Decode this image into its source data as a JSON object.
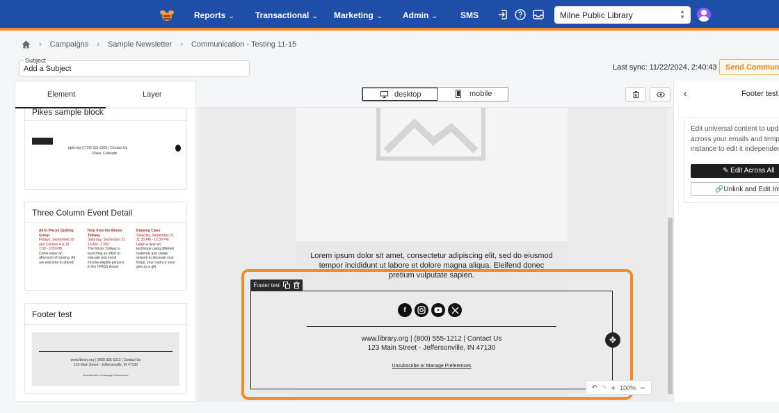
{
  "nav": {
    "items": [
      {
        "label": "Reports"
      },
      {
        "label": "Transactional"
      },
      {
        "label": "Marketing"
      },
      {
        "label": "Admin"
      },
      {
        "label": "SMS"
      }
    ],
    "chevron": "⌄",
    "library_select": "Milne Public Library"
  },
  "breadcrumb": {
    "items": [
      "Campaigns",
      "Sample Newsletter",
      "Communication - Testing 11-15"
    ]
  },
  "subject": {
    "label": "Subject",
    "value": "Add a Subject"
  },
  "sync": {
    "text": "Last sync: 11/22/2024, 2:40:43 PM"
  },
  "send_button": "Send Communication",
  "left_panel": {
    "tabs": [
      "Element",
      "Layer"
    ],
    "blocks": [
      {
        "title": "Pikes sample block",
        "preview_contact": "ppld.org  |  (719) 531-6333  |  Contact Us",
        "preview_city": "Pikes, Colorado"
      },
      {
        "title": "Three Column Event Detail",
        "col1_title": "All In Pieces Quilting Group",
        "col1_date": "Fridays, September 20 and October 4 & 18",
        "col1_time": "1:30 - 3:30 PM",
        "col1_body": "Come enjoy an afternoon of sewing. All are welcome to attend!",
        "col2_title": "Help from the Illinois Tollway",
        "col2_date": "Saturday, September 21",
        "col2_time": "10 AM - 2 PM",
        "col2_body": "The Illinois Tollway is launching an effort to educate and enroll income-eligible persons in the I-PASS Assist",
        "col3_title": "Drawing Class",
        "col3_date": "Saturday, September 21",
        "col3_time": "11:30 AM - 12:30 PM",
        "col3_body": "Learn a new art technique using different materials and create artwork to decorate your fridge, your room or even give as a gift."
      },
      {
        "title": "Footer test",
        "preview_contact": "www.library.org  |  (800) 555-1212  |  Contact Us",
        "preview_address": "123 Main Street - Jeffersonville, IN 47130",
        "preview_unsub": "Unsubscribe or Manage Preferences"
      }
    ]
  },
  "view_toggle": {
    "desktop": "desktop",
    "mobile": "mobile"
  },
  "canvas": {
    "lorem": "Lorem ipsum dolor sit amet, consectetur adipiscing elit, sed do eiusmod tempor incididunt ut labore et dolore magna aliqua. Eleifend donec pretium vulputate sapien.",
    "footer_tag": "Footer test",
    "footer_contact": "www.library.org   |   (800) 555-1212   |   Contact Us",
    "footer_address": "123 Main Street - Jeffersonville, IN 47130",
    "footer_unsub": "Unsubscribe or Manage Preferences",
    "social_icons": [
      "facebook-icon",
      "instagram-icon",
      "youtube-icon",
      "x-icon"
    ],
    "zoom": "100%"
  },
  "right_panel": {
    "title": "Footer test",
    "description_lines": [
      "Edit universal content to update",
      "across your emails and templates",
      "instance to edit it independently"
    ],
    "edit_all_button": "Edit Across All",
    "unlink_button": "Unlink and Edit Instance"
  },
  "colors": {
    "nav_bg": "#1f4ea8",
    "accent_orange": "#f28c28",
    "avatar": "#8b5cf6"
  }
}
